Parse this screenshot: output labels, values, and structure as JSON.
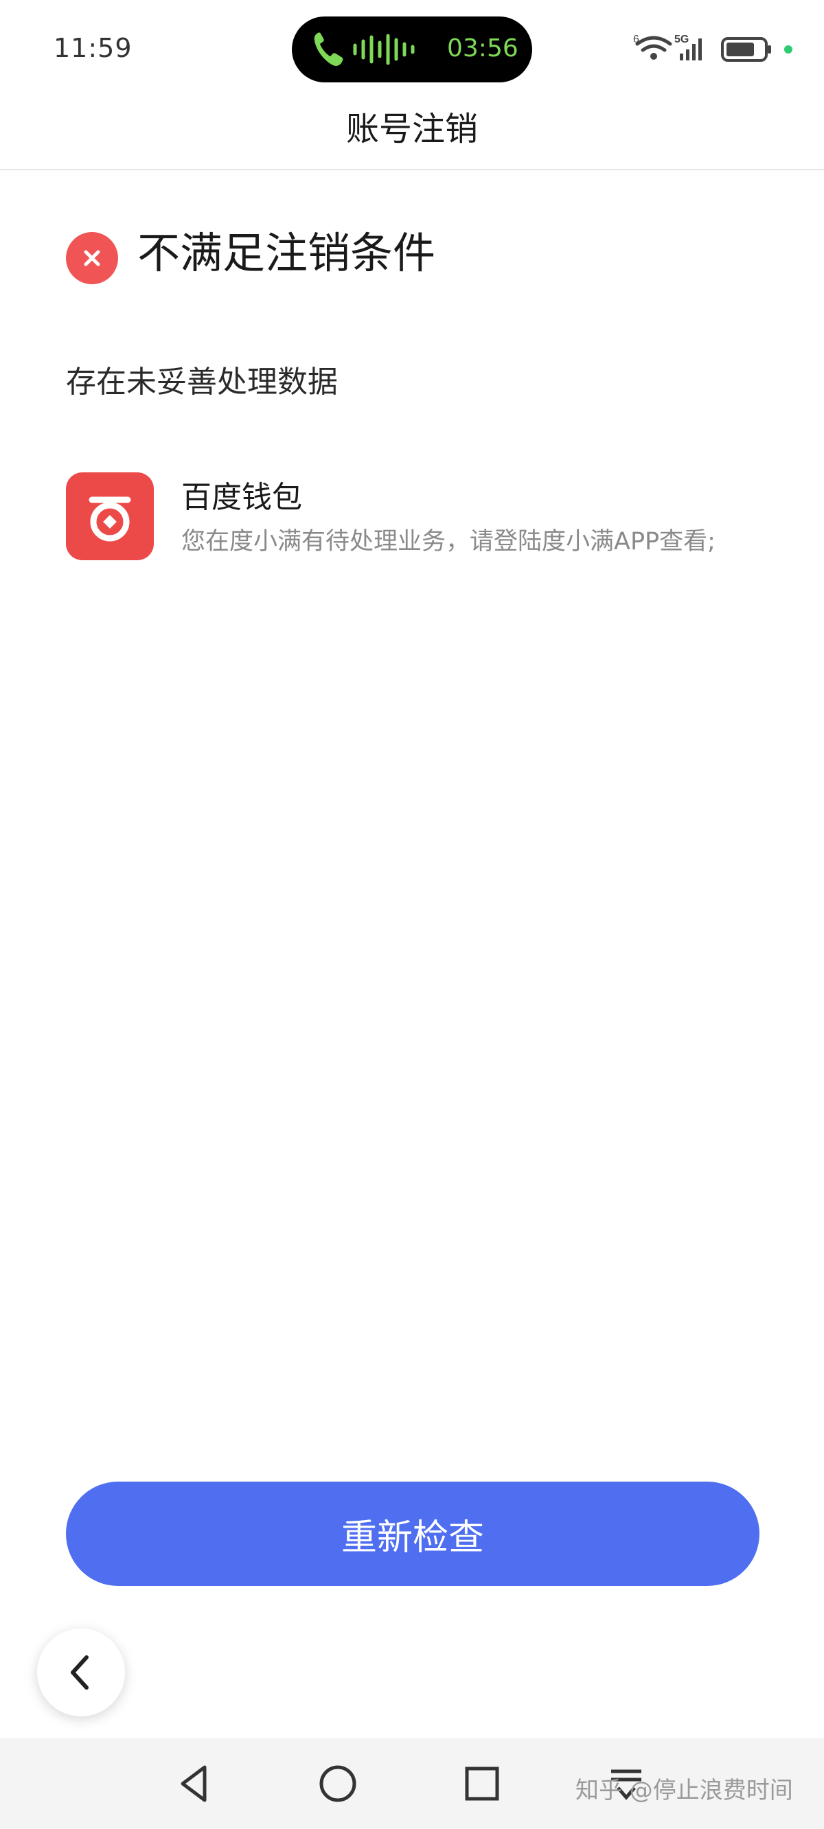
{
  "status_bar": {
    "time": "11:59",
    "call_timer": "03:56",
    "network_label": "5G",
    "wifi_label": "6",
    "icons": [
      "phone-icon",
      "voice-wave-icon",
      "wifi-icon",
      "signal-5g-icon",
      "battery-icon"
    ],
    "accent_color": "#7ed957"
  },
  "nav": {
    "title": "账号注销"
  },
  "result": {
    "status_icon": "error-x-icon",
    "status_color": "#f05454",
    "title": "不满足注销条件",
    "section_label": "存在未妥善处理数据"
  },
  "items": [
    {
      "icon": "baidu-wallet-icon",
      "icon_color": "#ec4a48",
      "name": "百度钱包",
      "description": "您在度小满有待处理业务，请登陆度小满APP查看;"
    }
  ],
  "actions": {
    "recheck_label": "重新检查",
    "recheck_color": "#4f6ef0"
  },
  "floating": {
    "back_icon": "chevron-left-icon"
  },
  "system_nav": {
    "buttons": [
      "back-triangle-icon",
      "home-circle-icon",
      "recents-square-icon",
      "menu-down-icon"
    ]
  },
  "watermark": "知乎 @停止浪费时间"
}
